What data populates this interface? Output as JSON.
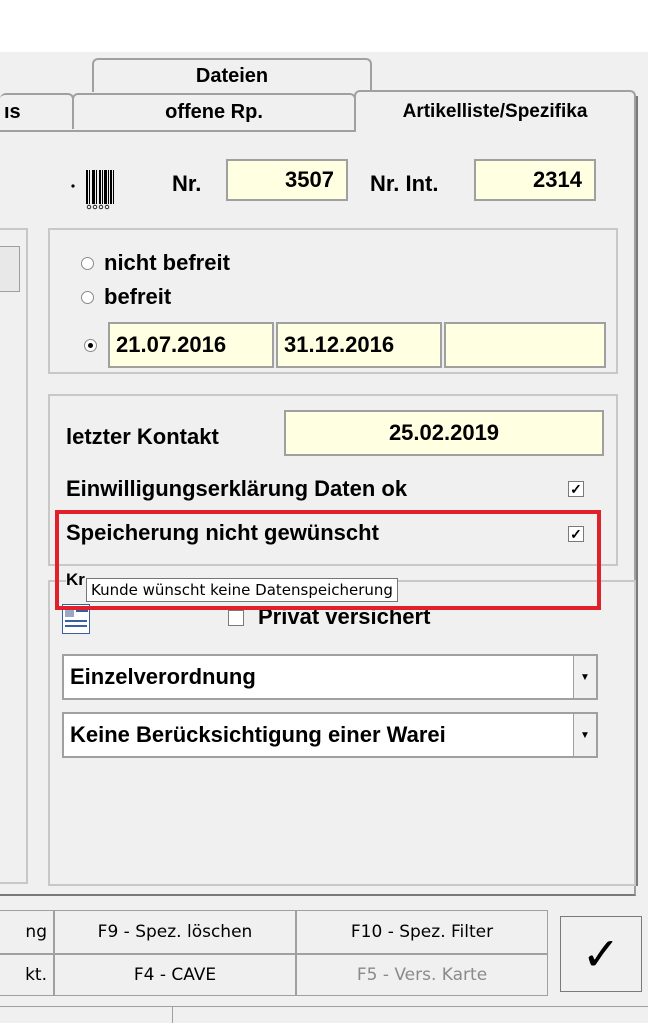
{
  "tabs": {
    "row1": [
      "Dateien"
    ],
    "row2": [
      "ıs",
      "offene Rp.",
      "Artikelliste/Spezifika"
    ]
  },
  "header": {
    "nr_label": "Nr.",
    "nr_value": "3507",
    "nr_int_label": "Nr. Int.",
    "nr_int_value": "2314"
  },
  "befreiung": {
    "option1": "nicht befreit",
    "option2": "befreit",
    "date_from": "21.07.2016",
    "date_to": "31.12.2016",
    "extra": "",
    "selected": 3
  },
  "kontakt": {
    "label": "letzter Kontakt",
    "value": "25.02.2019",
    "einwilligung_label": "Einwilligungserklärung Daten ok",
    "einwilligung_checked": true,
    "speicherung_label": "Speicherung nicht gewünscht",
    "speicherung_checked": true
  },
  "tooltip": "Kunde wünscht keine Datenspeicherung",
  "kr_label": "Kr",
  "privat_label": "Privat versichert",
  "combo1": "Einzelverordnung",
  "combo2": "Keine Berücksichtigung einer Warei",
  "fkeys": {
    "left_top": "ng",
    "left_bottom": "kt.",
    "f9": "F9 - Spez. löschen",
    "f10": "F10 - Spez. Filter",
    "f4": "F4 - CAVE",
    "f5": "F5 - Vers. Karte",
    "ok": "✓"
  },
  "colors": {
    "highlight": "#e0202a",
    "field_bg": "#ffffe1",
    "disabled_text": "#8a8a8a"
  }
}
